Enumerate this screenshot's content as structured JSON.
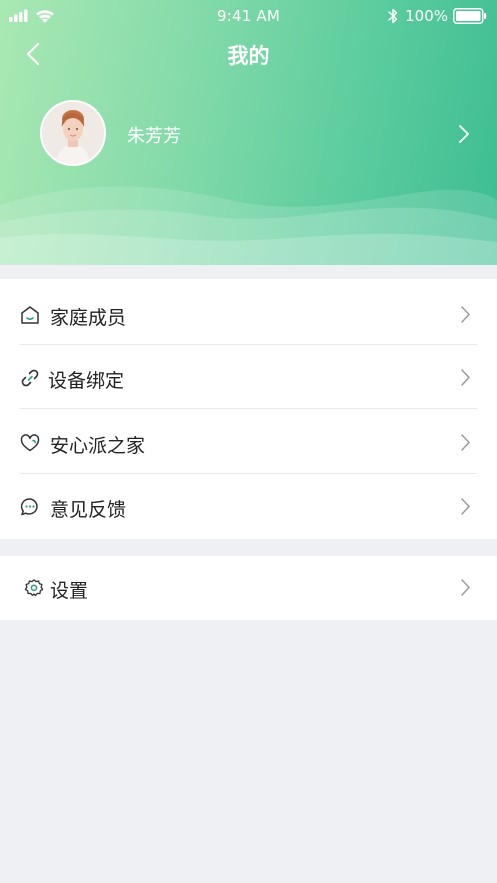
{
  "status_bar": {
    "time": "9:41 AM",
    "battery": "100%"
  },
  "nav": {
    "title": "我的"
  },
  "profile": {
    "name": "朱芳芳"
  },
  "menu": {
    "items": [
      {
        "label": "家庭成员",
        "icon": "home-icon"
      },
      {
        "label": "设备绑定",
        "icon": "link-icon"
      },
      {
        "label": "安心派之家",
        "icon": "heart-icon"
      },
      {
        "label": "意见反馈",
        "icon": "chat-bubble-icon"
      }
    ]
  },
  "settings": {
    "label": "设置",
    "icon": "gear-icon"
  },
  "colors": {
    "header_gradient_start": "#a9e8b3",
    "header_gradient_end": "#3cbd92",
    "icon_accent": "#2e9e86",
    "page_background": "#eff0f4"
  }
}
